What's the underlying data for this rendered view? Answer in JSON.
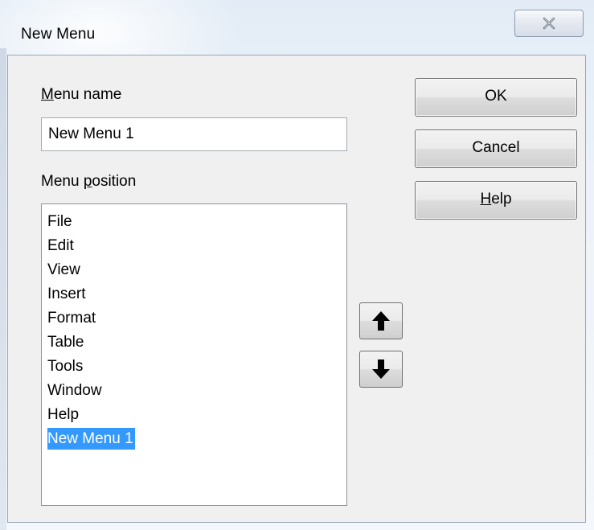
{
  "window": {
    "title": "New Menu",
    "close_icon": "close-icon"
  },
  "menu_name": {
    "label_underlined": "M",
    "label_rest": "enu name",
    "value": "New Menu 1"
  },
  "menu_position": {
    "label_before": "Menu ",
    "label_underlined": "p",
    "label_after": "osition",
    "items": [
      "File",
      "Edit",
      "View",
      "Insert",
      "Format",
      "Table",
      "Tools",
      "Window",
      "Help",
      "New Menu 1"
    ],
    "selected_index": 9
  },
  "buttons": {
    "ok": "OK",
    "cancel": "Cancel",
    "help_underlined": "H",
    "help_rest": "elp"
  },
  "move_buttons": {
    "up_icon": "arrow-up-icon",
    "down_icon": "arrow-down-icon"
  },
  "colors": {
    "selection": "#3399ff"
  }
}
